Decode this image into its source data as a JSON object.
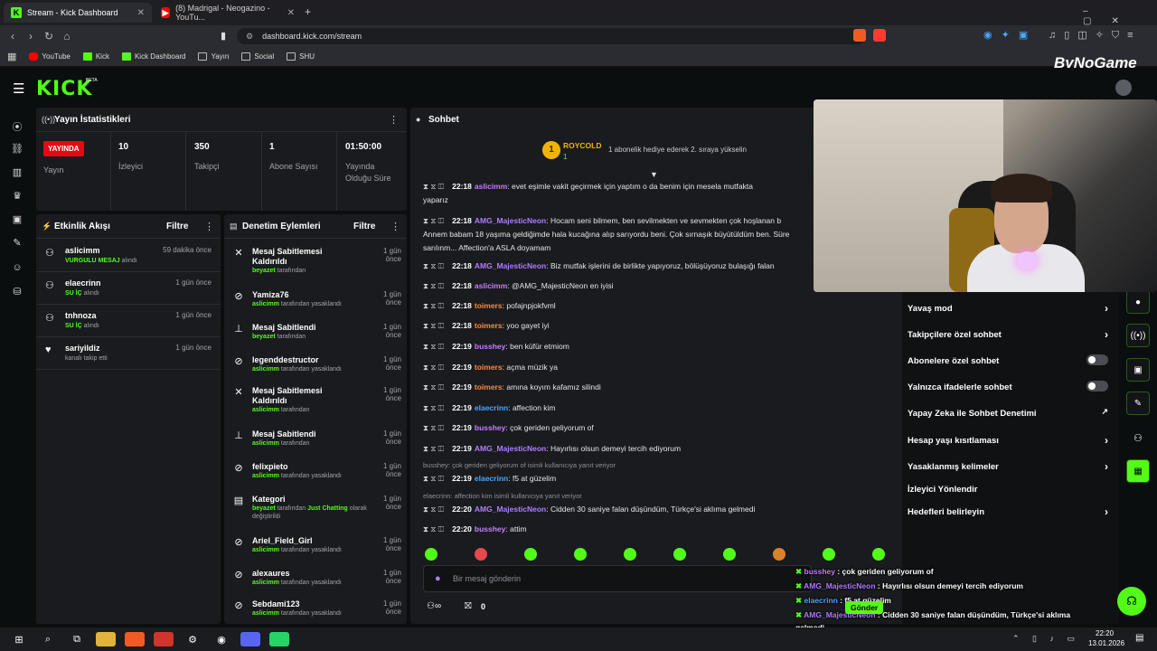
{
  "browser": {
    "tabs": [
      {
        "label": "Stream - Kick Dashboard",
        "active": true
      },
      {
        "label": "(8) Madrigal - Neogazino - YouTu..."
      }
    ],
    "new_tab": "+",
    "url": "dashboard.kick.com/stream",
    "bookmarks": [
      "YouTube",
      "Kick",
      "Kick Dashboard",
      "Yayın",
      "Social",
      "SHU"
    ]
  },
  "overlay_brand": "ByNoGame",
  "app": {
    "logo": "KICK",
    "beta": "BETA"
  },
  "stats": {
    "title": "Yayın İstatistikleri",
    "live_badge": "YAYINDA",
    "live_label": "Yayın",
    "viewers": {
      "value": "10",
      "label": "İzleyici"
    },
    "followers": {
      "value": "350",
      "label": "Takipçi"
    },
    "subs": {
      "value": "1",
      "label": "Abone Sayısı"
    },
    "uptime": {
      "value": "01:50:00",
      "label1": "Yayında",
      "label2": "Olduğu Süre"
    }
  },
  "activity": {
    "title": "Etkinlik Akışı",
    "filter": "Filtre",
    "items": [
      {
        "name": "aslicimm",
        "tag": "VURGULU MESAJ",
        "suffix": " alındı",
        "time": "59 dakika önce"
      },
      {
        "name": "elaecrinn",
        "tag": "SU İÇ",
        "suffix": " alındı",
        "time": "1 gün önce"
      },
      {
        "name": "tnhnoza",
        "tag": "SU İÇ",
        "suffix": " alındı",
        "time": "1 gün önce"
      },
      {
        "name": "sariyildiz",
        "tag": "",
        "suffix": "kanalı takip etti",
        "time": "1 gün önce"
      }
    ]
  },
  "moderation": {
    "title": "Denetim Eylemleri",
    "filter": "Filtre",
    "items": [
      {
        "t1": "Mesaj Sabitlemesi",
        "t2": "Kaldırıldı",
        "user": "beyazet",
        "rest": " tarafından",
        "time1": "1 gün",
        "time2": "önce"
      },
      {
        "t1": "Yamiza76",
        "t2": "",
        "user": "aslicimm",
        "rest": " tarafından yasaklandı",
        "time1": "1 gün önce",
        "time2": ""
      },
      {
        "t1": "Mesaj Sabitlendi",
        "t2": "",
        "user": "beyazet",
        "rest": " tarafından",
        "time1": "1 gün önce",
        "time2": ""
      },
      {
        "t1": "legenddestructor",
        "t2": "",
        "user": "aslicimm",
        "rest": " tarafından yasaklandı",
        "time1": "1 gün önce",
        "time2": ""
      },
      {
        "t1": "Mesaj Sabitlemesi",
        "t2": "Kaldırıldı",
        "user": "aslicimm",
        "rest": " tarafından",
        "time1": "1 gün",
        "time2": "önce"
      },
      {
        "t1": "Mesaj Sabitlendi",
        "t2": "",
        "user": "aslicimm",
        "rest": " tarafından",
        "time1": "1 gün önce",
        "time2": ""
      },
      {
        "t1": "felixpieto",
        "t2": "",
        "user": "aslicimm",
        "rest": " tarafından yasaklandı",
        "time1": "1 gün önce",
        "time2": ""
      },
      {
        "t1": "Kategori",
        "t2": "",
        "user": "beyazet",
        "rest": " tarafından ",
        "extra": "Just Chatting",
        "rest2": " olarak",
        "line3": "değiştirildi",
        "time1": "1 gün önce",
        "time2": ""
      },
      {
        "t1": "Ariel_Field_Girl",
        "t2": "",
        "user": "aslicimm",
        "rest": " tarafından yasaklandı",
        "time1": "1 gün önce",
        "time2": ""
      },
      {
        "t1": "alexaures",
        "t2": "",
        "user": "aslicimm",
        "rest": " tarafından yasaklandı",
        "time1": "1 gün önce",
        "time2": ""
      },
      {
        "t1": "Sebdami123",
        "t2": "",
        "user": "aslicimm",
        "rest": " tarafından yasaklandı",
        "time1": "1 gün önce",
        "time2": ""
      }
    ]
  },
  "chat": {
    "title": "Sohbet",
    "top_gifter": {
      "rank": "1",
      "name": "ROYCOLD",
      "count": "1"
    },
    "gift_hint": "1 abonelik hediye ederek 2. sıraya yükselin",
    "messages": [
      {
        "time": "22:18",
        "user": "aslicimm",
        "cls": "u-v",
        "text": "evet eşimle vakit geçirmek için yaptım o da benim için mesela mutfakta",
        "cont": "yaparız"
      },
      {
        "time": "22:18",
        "user": "AMG_MajesticNeon",
        "cls": "u-p",
        "text": "Hocam seni bilmem, ben sevilmekten ve sevmekten çok hoşlanan b",
        "cont": "Annem babam 18 yaşıma geldiğimde hala kucağına alıp sarıyordu beni. Çok sırnaşık büyütüldüm ben. Süre",
        "cont2": "sarılınm... Affection'a ASLA doyamam"
      },
      {
        "time": "22:18",
        "user": "AMG_MajesticNeon",
        "cls": "u-p",
        "text": "Biz mutfak işlerini de birlikte yapıyoruz, bölüşüyoruz bulaşığı falan"
      },
      {
        "time": "22:18",
        "user": "aslicimm",
        "cls": "u-v",
        "text": "@AMG_MajesticNeon en iyisi"
      },
      {
        "time": "22:18",
        "user": "toimers",
        "cls": "u-o",
        "text": "pofajnpjokfvml"
      },
      {
        "time": "22:18",
        "user": "toimers",
        "cls": "u-o",
        "text": "yoo gayet iyi"
      },
      {
        "time": "22:19",
        "user": "busshey",
        "cls": "u-v",
        "text": "ben küfür etmiom"
      },
      {
        "time": "22:19",
        "user": "toimers",
        "cls": "u-o",
        "text": "açma müzik ya"
      },
      {
        "time": "22:19",
        "user": "toimers",
        "cls": "u-o",
        "text": "amına koyım kafamız silindi"
      },
      {
        "time": "22:19",
        "user": "elaecrinn",
        "cls": "u-b",
        "text": "affection kim"
      },
      {
        "time": "22:19",
        "user": "busshey",
        "cls": "u-v",
        "text": "çok geriden geliyorum of"
      },
      {
        "time": "22:19",
        "user": "AMG_MajesticNeon",
        "cls": "u-p",
        "text": "Hayırlısı olsun demeyi tercih ediyorum"
      }
    ],
    "reply1": "busshey: çok geriden geliyorum of isimli kullanıcıya yanıt veriyor",
    "msg_r1": {
      "time": "22:19",
      "user": "elaecrinn",
      "text": "f5 at güzelim"
    },
    "reply2": "elaecrinn: affection kim isimli kullanıcıya yanıt veriyor",
    "msg_r2": {
      "time": "22:20",
      "user": "AMG_MajesticNeon",
      "text": "Cidden 30 saniye falan düşündüm, Türkçe'si aklıma gelmedi"
    },
    "msg_last": {
      "time": "22:20",
      "user": "busshey",
      "text": "attim"
    },
    "input_placeholder": "Bir mesaj gönderin",
    "send": "Gönder",
    "count": "0"
  },
  "settings": [
    {
      "label": "Yavaş mod",
      "kind": "chev"
    },
    {
      "label": "Takipçilere özel sohbet",
      "kind": "chev"
    },
    {
      "label": "Abonelere özel sohbet",
      "kind": "toggle"
    },
    {
      "label": "Yalnızca ifadelerle sohbet",
      "kind": "toggle"
    },
    {
      "label": "Yapay Zeka ile Sohbet Denetimi",
      "kind": "ext"
    },
    {
      "label": "Hesap yaşı kısıtlaması",
      "kind": "chev"
    },
    {
      "label": "Yasaklanmış kelimeler",
      "kind": "chev"
    },
    {
      "label": "İzleyici Yönlendir",
      "kind": ""
    },
    {
      "label": "Hedefleri belirleyin",
      "kind": "chev"
    }
  ],
  "overlay_chat": [
    {
      "user": "busshey",
      "text": " : çok geriden geliyorum of"
    },
    {
      "user": "AMG_MajesticNeon",
      "text": " : Hayırlısı olsun demeyi tercih ediyorum"
    },
    {
      "user": "elaecrinn",
      "text": " : f5 at güzelim"
    },
    {
      "user": "AMG_MajesticNeon",
      "text": " : Cidden 30 saniye falan düşündüm, Türkçe'si aklıma"
    },
    {
      "user": "",
      "text": "gelmedi"
    },
    {
      "user": "busshey",
      "text": " : attim"
    }
  ],
  "taskbar": {
    "time": "22:20",
    "date": "13.01.2026"
  },
  "colors": {
    "kick_green": "#53fc18",
    "live_red": "#e50914",
    "panel": "#191b1f"
  }
}
